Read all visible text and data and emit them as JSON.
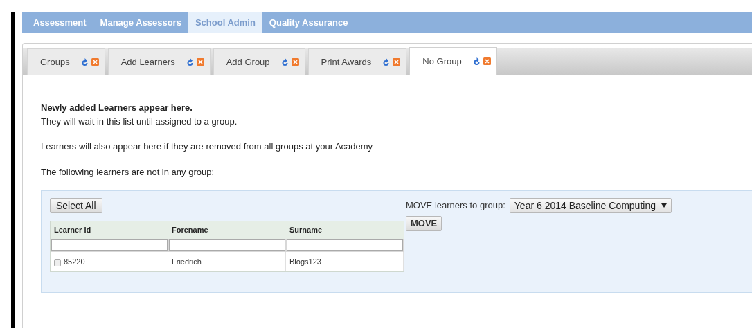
{
  "nav": [
    {
      "label": "Assessment",
      "selected": false
    },
    {
      "label": "Manage Assessors",
      "selected": false
    },
    {
      "label": "School Admin",
      "selected": true
    },
    {
      "label": "Quality Assurance",
      "selected": false
    }
  ],
  "tabs": [
    {
      "label": "Groups",
      "selected": false
    },
    {
      "label": "Add Learners",
      "selected": false
    },
    {
      "label": "Add Group",
      "selected": false
    },
    {
      "label": "Print Awards",
      "selected": false
    },
    {
      "label": "No Group",
      "selected": true
    }
  ],
  "intro": {
    "heading": "Newly added Learners appear here.",
    "lines": [
      "They will wait in this list until assigned to a group.",
      "Learners will also appear here if they are removed from all groups at your Academy",
      "The following learners are not in any group:"
    ]
  },
  "panel": {
    "select_all": "Select All",
    "move_label": "MOVE learners to group:",
    "group_select": "Year 6 2014 Baseline Computing",
    "move_button": "MOVE",
    "table": {
      "columns": [
        "Learner Id",
        "Forename",
        "Surname"
      ],
      "rows": [
        {
          "cells": [
            "85220",
            "Friedrich",
            "Blogs123"
          ],
          "checked": false
        }
      ]
    }
  }
}
